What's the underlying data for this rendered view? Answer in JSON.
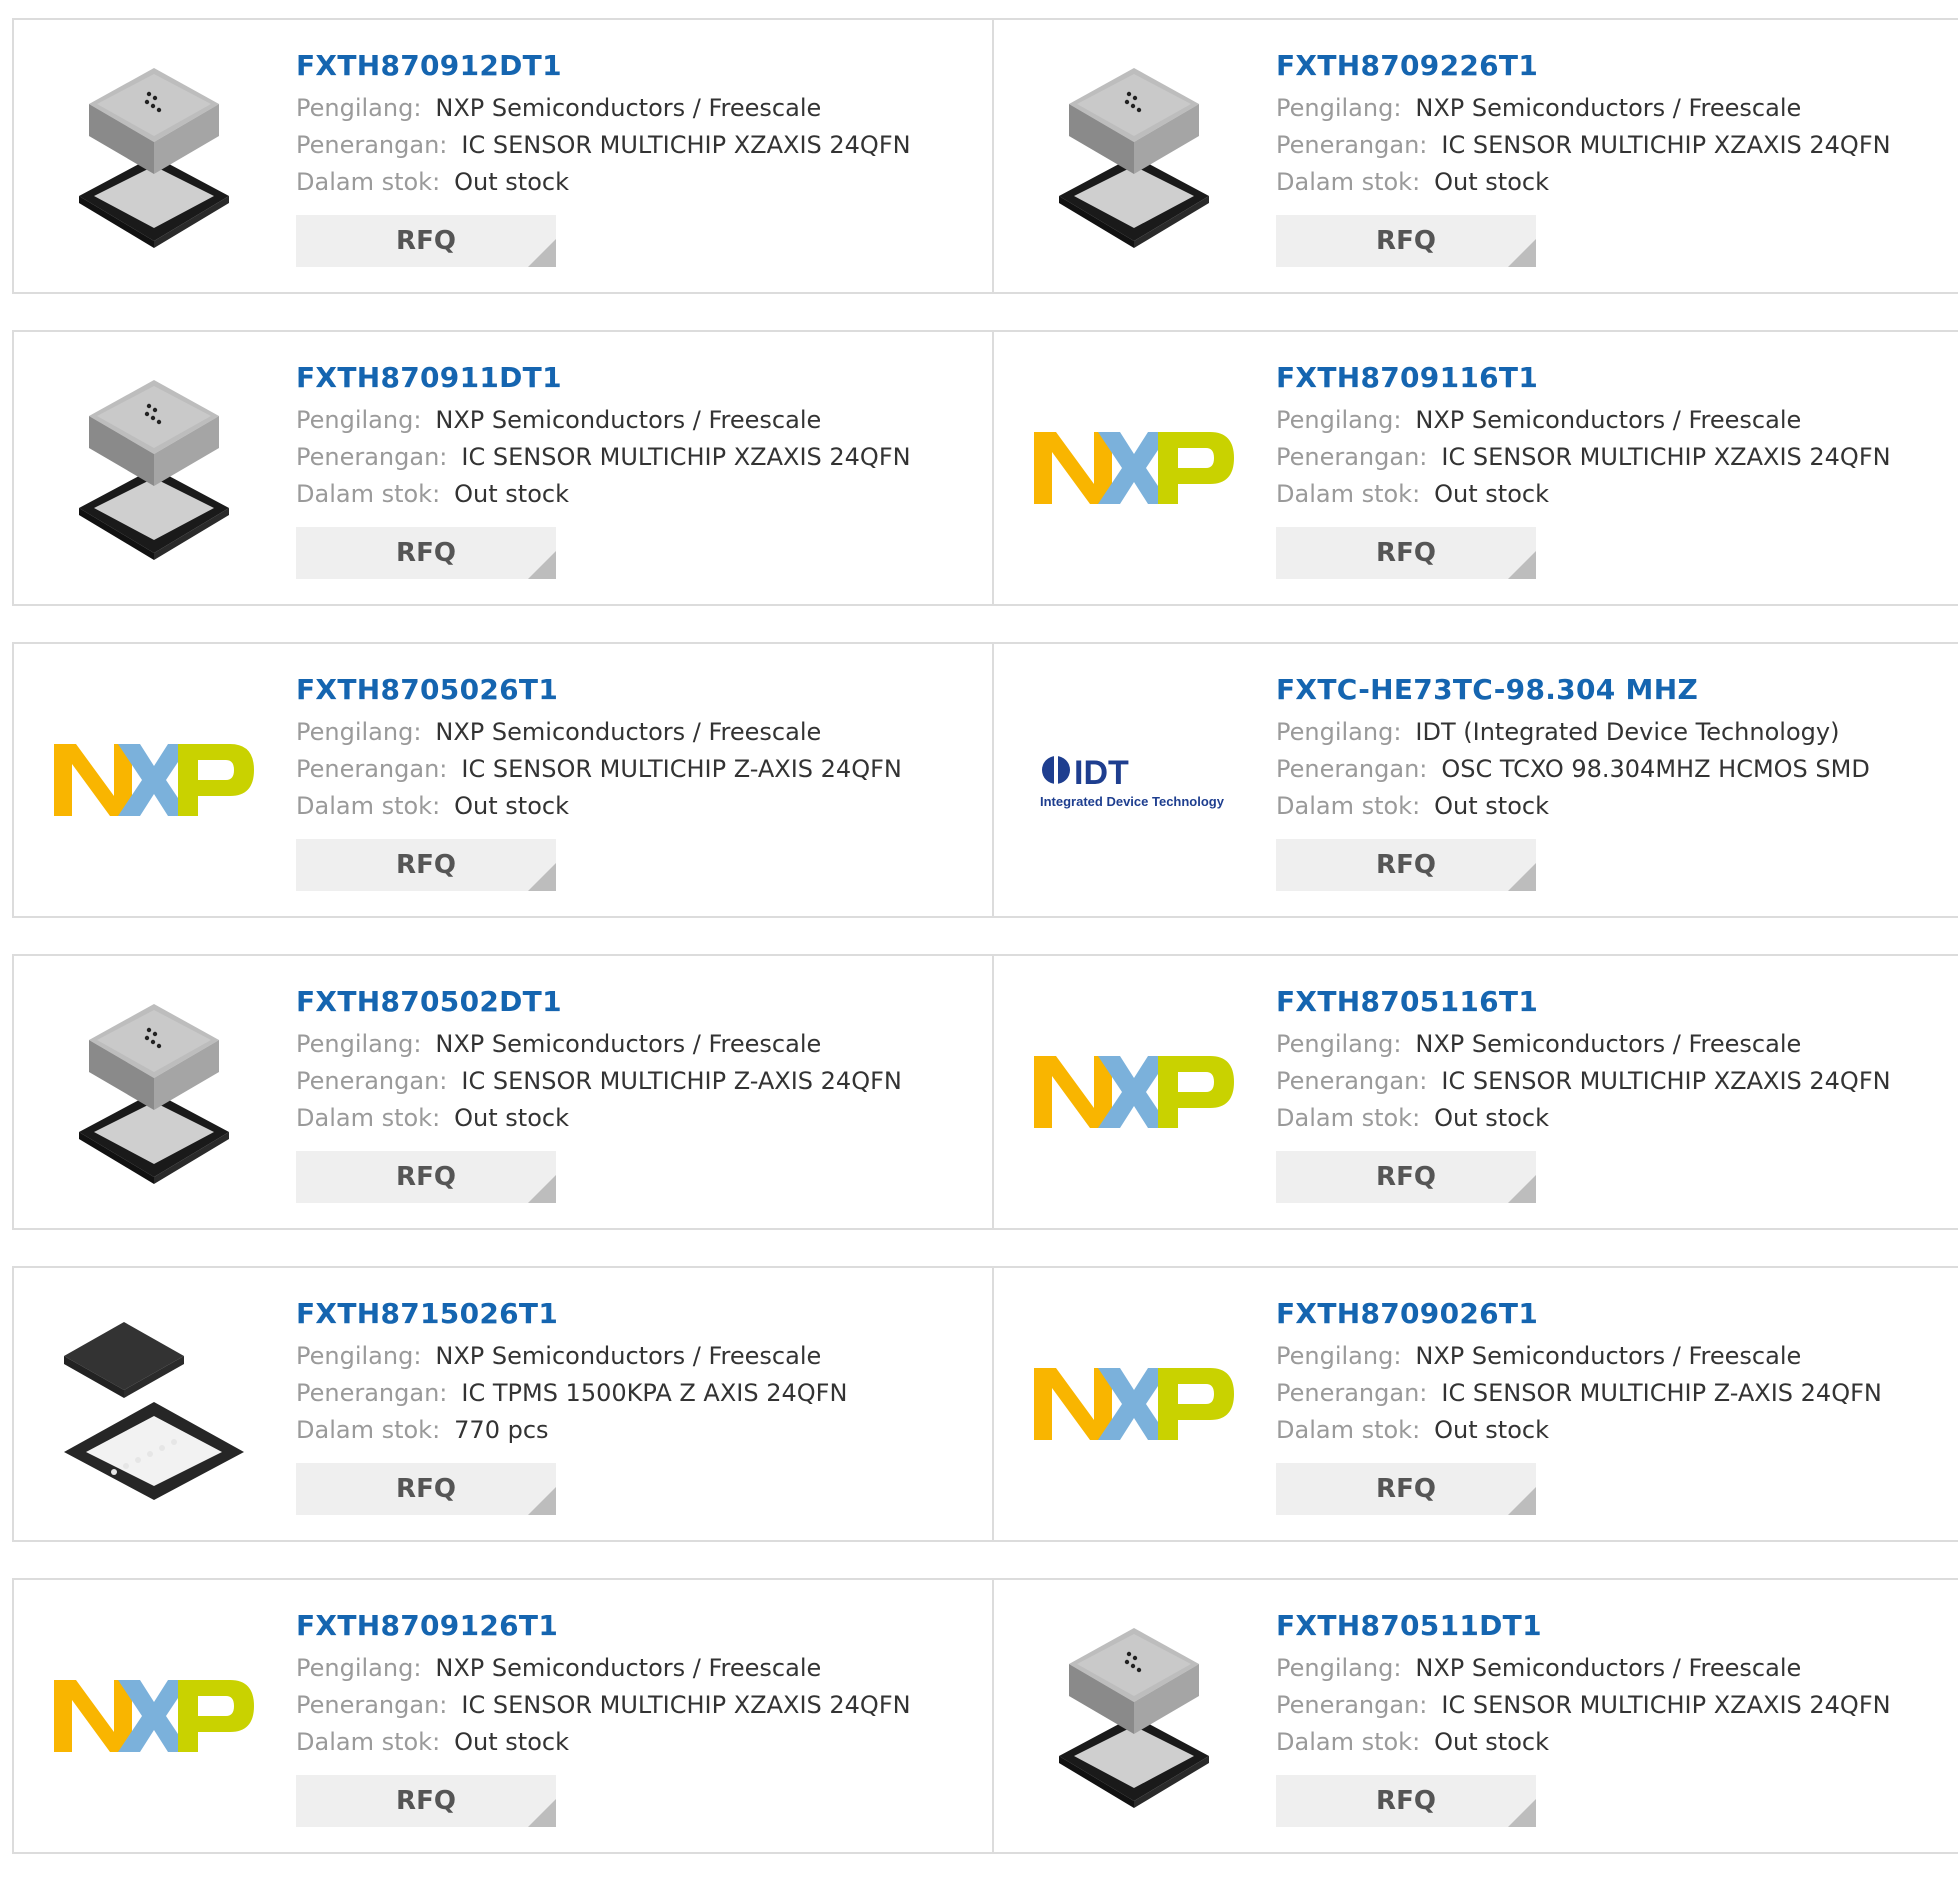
{
  "labels": {
    "manufacturer": "Pengilang:",
    "description": "Penerangan:",
    "stock": "Dalam stok:",
    "rfq": "RFQ"
  },
  "logos": {
    "nxp": {
      "text": "NXP",
      "colors": [
        "#f9b500",
        "#7bb1db",
        "#c9d200"
      ]
    },
    "idt": {
      "brand": "IDT",
      "tagline": "Integrated Device Technology",
      "color": "#1e3e8f"
    }
  },
  "products": [
    {
      "part": "FXTH870912DT1",
      "manufacturer": "NXP Semiconductors / Freescale",
      "description": "IC SENSOR MULTICHIP XZAXIS 24QFN",
      "stock": "Out stock",
      "image": "qfn-chip-stack"
    },
    {
      "part": "FXTH8709226T1",
      "manufacturer": "NXP Semiconductors / Freescale",
      "description": "IC SENSOR MULTICHIP XZAXIS 24QFN",
      "stock": "Out stock",
      "image": "qfn-chip-stack"
    },
    {
      "part": "FXTH870911DT1",
      "manufacturer": "NXP Semiconductors / Freescale",
      "description": "IC SENSOR MULTICHIP XZAXIS 24QFN",
      "stock": "Out stock",
      "image": "qfn-chip-stack"
    },
    {
      "part": "FXTH8709116T1",
      "manufacturer": "NXP Semiconductors / Freescale",
      "description": "IC SENSOR MULTICHIP XZAXIS 24QFN",
      "stock": "Out stock",
      "image": "nxp-logo"
    },
    {
      "part": "FXTH8705026T1",
      "manufacturer": "NXP Semiconductors / Freescale",
      "description": "IC SENSOR MULTICHIP Z-AXIS 24QFN",
      "stock": "Out stock",
      "image": "nxp-logo"
    },
    {
      "part": "FXTC-HE73TC-98.304 MHZ",
      "manufacturer": "IDT (Integrated Device Technology)",
      "description": "OSC TCXO 98.304MHZ HCMOS SMD",
      "stock": "Out stock",
      "image": "idt-logo"
    },
    {
      "part": "FXTH870502DT1",
      "manufacturer": "NXP Semiconductors / Freescale",
      "description": "IC SENSOR MULTICHIP Z-AXIS 24QFN",
      "stock": "Out stock",
      "image": "qfn-chip-stack"
    },
    {
      "part": "FXTH8705116T1",
      "manufacturer": "NXP Semiconductors / Freescale",
      "description": "IC SENSOR MULTICHIP XZAXIS 24QFN",
      "stock": "Out stock",
      "image": "nxp-logo"
    },
    {
      "part": "FXTH8715026T1",
      "manufacturer": "NXP Semiconductors / Freescale",
      "description": "IC TPMS 1500KPA Z AXIS 24QFN",
      "stock": "770 pcs",
      "image": "qfn-black-chip"
    },
    {
      "part": "FXTH8709026T1",
      "manufacturer": "NXP Semiconductors / Freescale",
      "description": "IC SENSOR MULTICHIP Z-AXIS 24QFN",
      "stock": "Out stock",
      "image": "nxp-logo"
    },
    {
      "part": "FXTH8709126T1",
      "manufacturer": "NXP Semiconductors / Freescale",
      "description": "IC SENSOR MULTICHIP XZAXIS 24QFN",
      "stock": "Out stock",
      "image": "nxp-logo"
    },
    {
      "part": "FXTH870511DT1",
      "manufacturer": "NXP Semiconductors / Freescale",
      "description": "IC SENSOR MULTICHIP XZAXIS 24QFN",
      "stock": "Out stock",
      "image": "qfn-chip-stack"
    }
  ]
}
